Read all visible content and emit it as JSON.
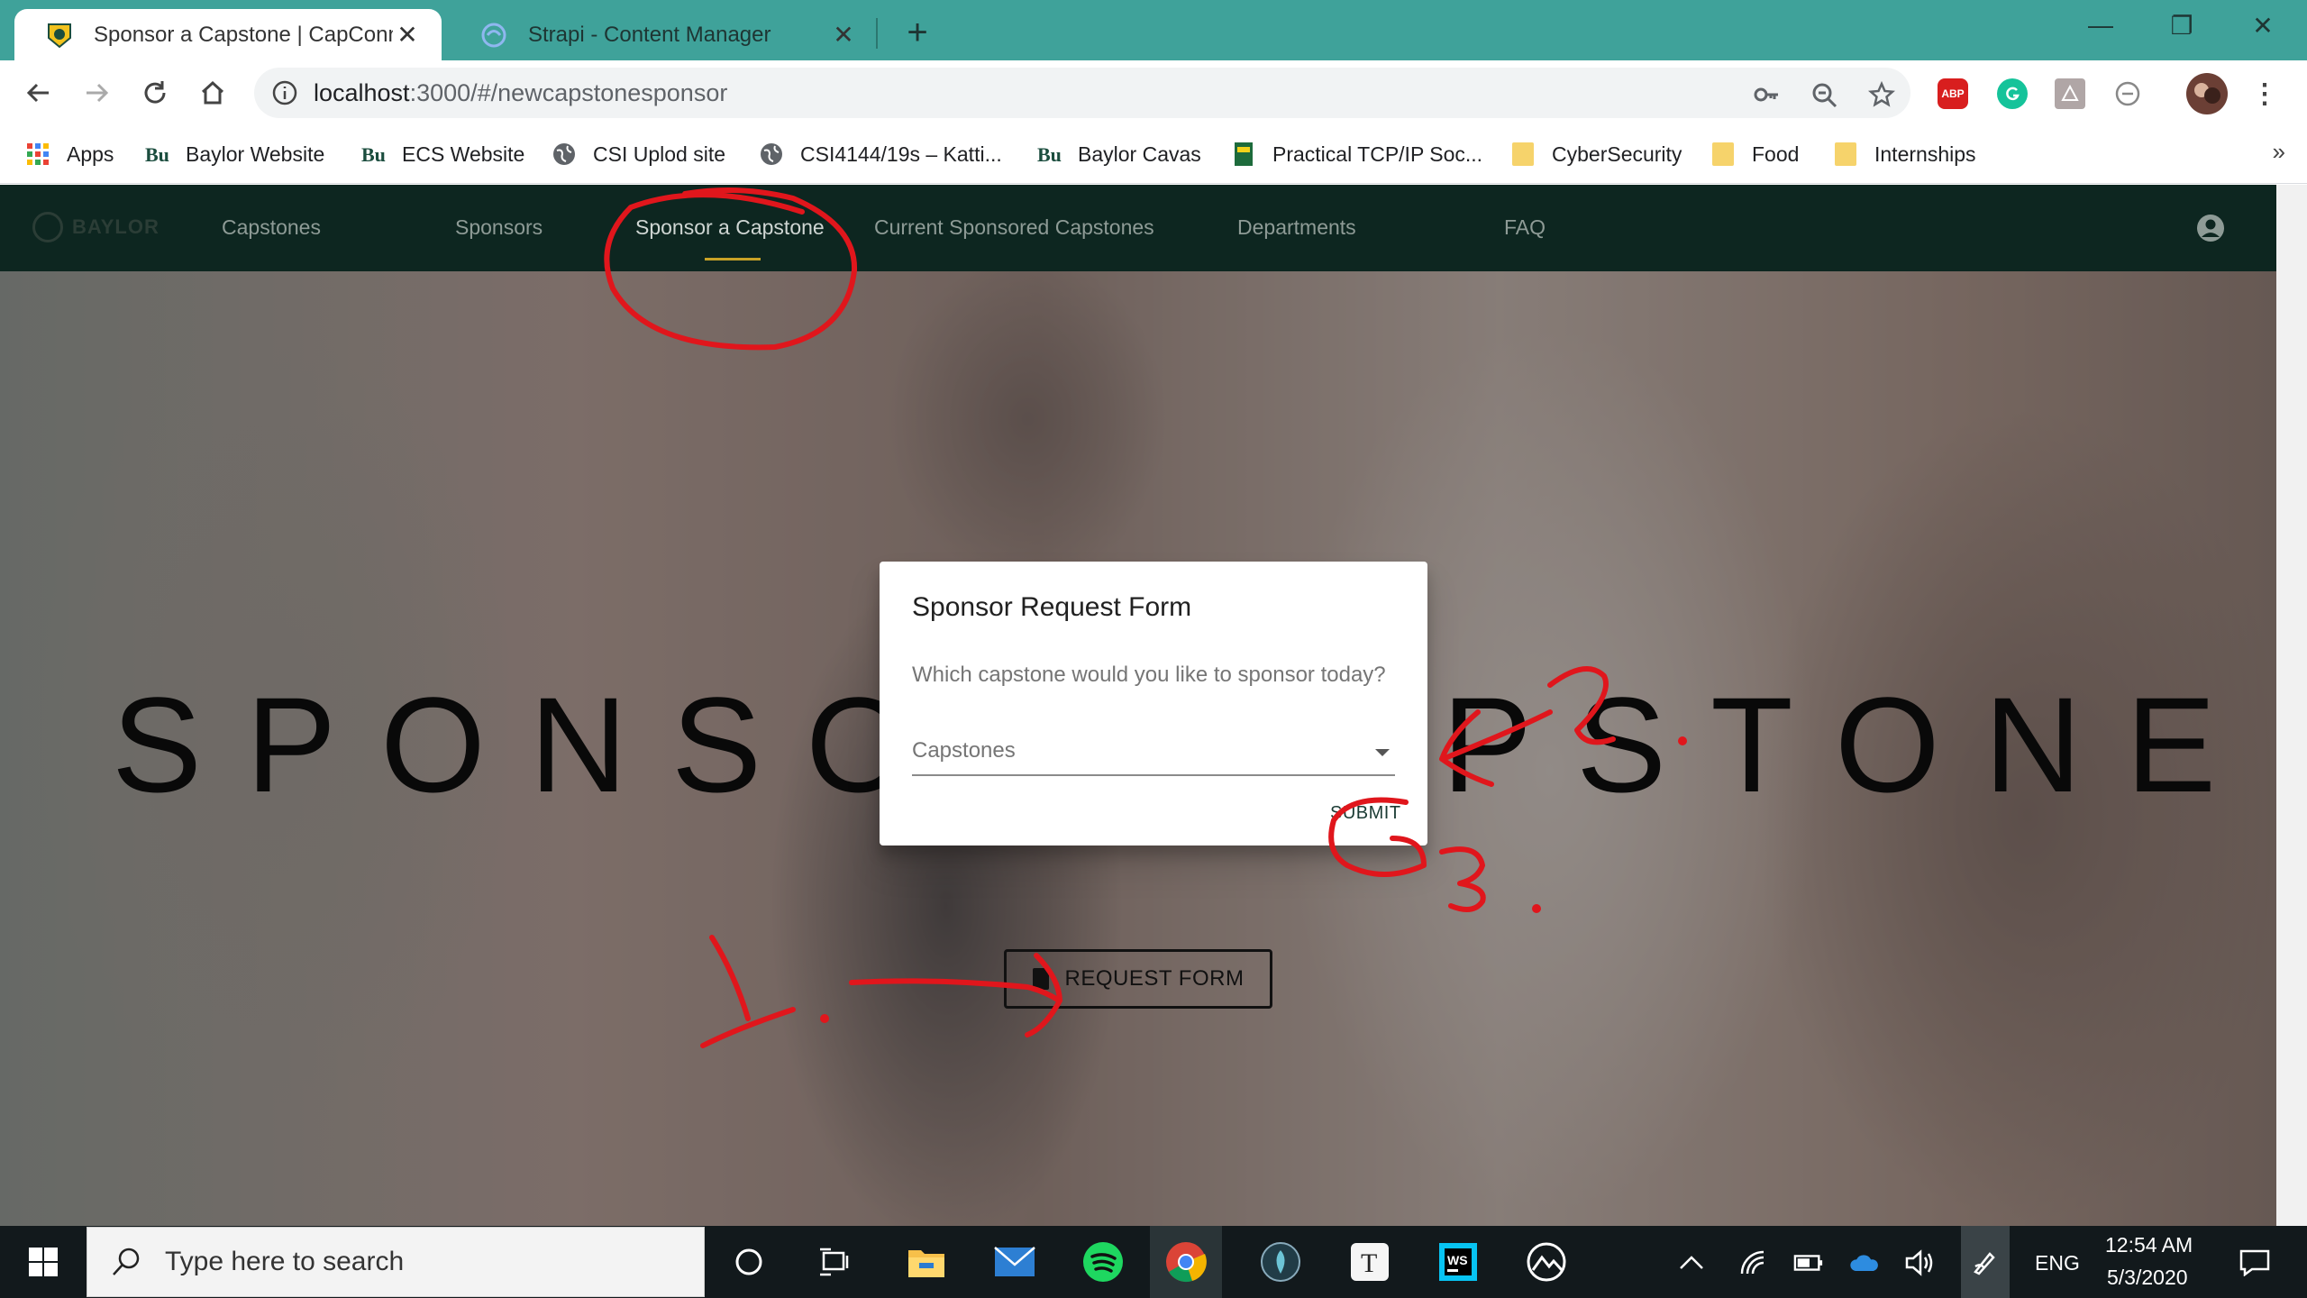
{
  "browser": {
    "tabs": [
      {
        "title": "Sponsor a Capstone | CapConnect",
        "close": "✕",
        "active": true
      },
      {
        "title": "Strapi - Content Manager",
        "close": "✕",
        "active": false
      }
    ],
    "new_tab": "+",
    "window_controls": {
      "minimize": "—",
      "restore": "❐",
      "close": "✕"
    },
    "url_host": "localhost",
    "url_rest": ":3000/#/newcapstonesponsor",
    "extensions": [
      "key-icon",
      "zoom-icon",
      "star-icon",
      "abp-icon",
      "grammarly-icon",
      "acrobat-icon",
      "minus-circle-icon",
      "profile-avatar",
      "menu-icon"
    ],
    "abp_label": "ABP"
  },
  "bookmarks": {
    "items": [
      {
        "label": "Apps",
        "icon": "apps-grid-icon"
      },
      {
        "label": "Baylor Website",
        "icon": "baylor-bu-icon"
      },
      {
        "label": "ECS Website",
        "icon": "baylor-bu-icon"
      },
      {
        "label": "CSI Uplod site",
        "icon": "globe-icon"
      },
      {
        "label": "CSI4144/19s – Katti...",
        "icon": "globe-icon"
      },
      {
        "label": "Baylor Cavas",
        "icon": "baylor-bu-icon"
      },
      {
        "label": "Practical TCP/IP Soc...",
        "icon": "book-icon"
      },
      {
        "label": "CyberSecurity",
        "icon": "folder-icon"
      },
      {
        "label": "Food",
        "icon": "folder-icon"
      },
      {
        "label": "Internships",
        "icon": "folder-icon"
      }
    ],
    "overflow": "»"
  },
  "app": {
    "logo_text": "BAYLOR",
    "nav": [
      {
        "label": "Capstones",
        "active": false
      },
      {
        "label": "Sponsors",
        "active": false
      },
      {
        "label": "Sponsor a Capstone",
        "active": true
      },
      {
        "label": "Current Sponsored Capstones",
        "active": false
      },
      {
        "label": "Departments",
        "active": false
      },
      {
        "label": "FAQ",
        "active": false
      }
    ],
    "accent_color": "#c9a227",
    "nav_bg": "#0d2620"
  },
  "hero": {
    "title_left": "SPONSOR",
    "title_right": "PSTONE",
    "request_button": "REQUEST FORM"
  },
  "dialog": {
    "title": "Sponsor Request Form",
    "question": "Which capstone would you like to sponsor today?",
    "select_value": "Capstones",
    "submit": "SUBMIT"
  },
  "annotations": {
    "color": "#e0161c",
    "labels": [
      "1.",
      "2.",
      "3."
    ]
  },
  "taskbar": {
    "search_placeholder": "Type here to search",
    "apps": [
      "cortana-icon",
      "task-view-icon",
      "file-explorer-icon",
      "mail-icon",
      "spotify-icon",
      "chrome-icon",
      "app-icon",
      "typora-icon",
      "webstorm-icon",
      "photos-icon"
    ],
    "language": "ENG",
    "time": "12:54 AM",
    "date": "5/3/2020"
  }
}
